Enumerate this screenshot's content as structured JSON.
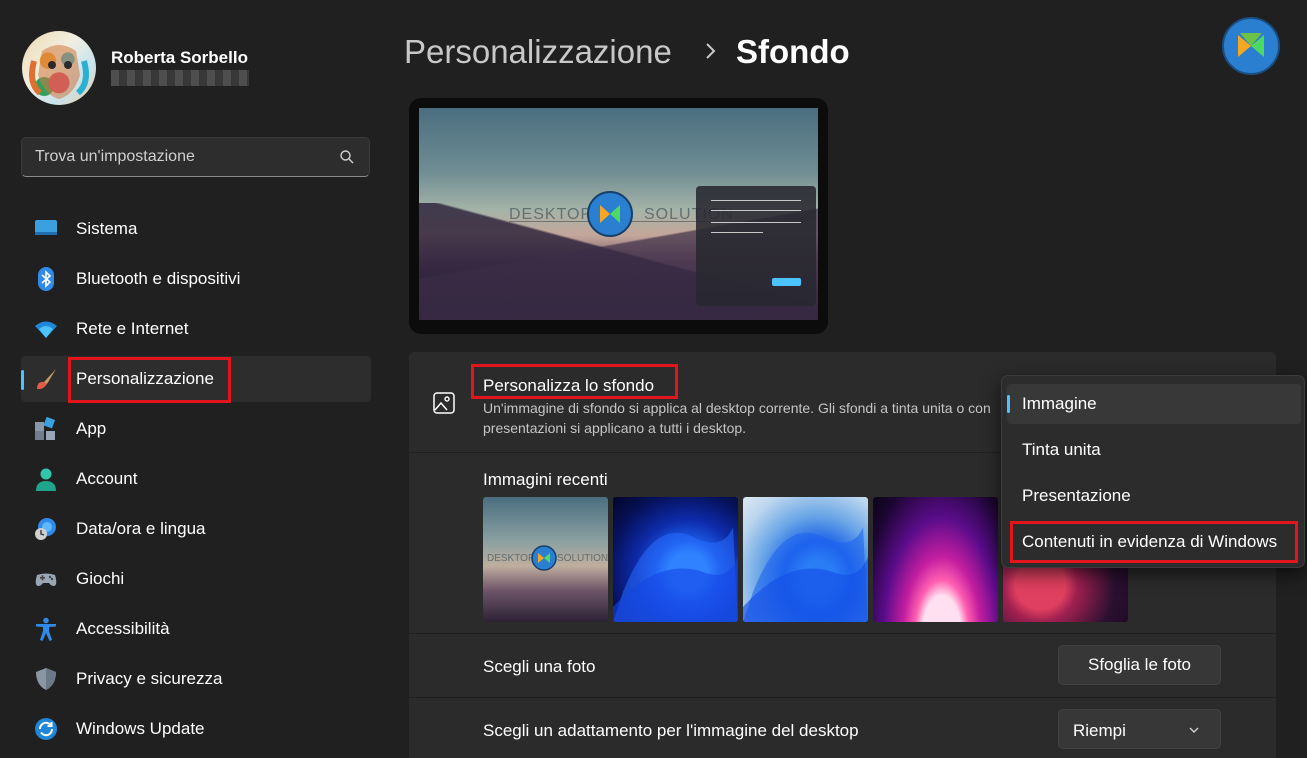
{
  "user": {
    "name": "Roberta Sorbello"
  },
  "search": {
    "placeholder": "Trova un'impostazione"
  },
  "sidebar": {
    "items": [
      {
        "label": "Sistema"
      },
      {
        "label": "Bluetooth e dispositivi"
      },
      {
        "label": "Rete e Internet"
      },
      {
        "label": "Personalizzazione",
        "active": true
      },
      {
        "label": "App"
      },
      {
        "label": "Account"
      },
      {
        "label": "Data/ora e lingua"
      },
      {
        "label": "Giochi"
      },
      {
        "label": "Accessibilità"
      },
      {
        "label": "Privacy e sicurezza"
      },
      {
        "label": "Windows Update"
      }
    ]
  },
  "header": {
    "breadcrumb_parent": "Personalizzazione",
    "breadcrumb_current": "Sfondo"
  },
  "preview": {
    "text_left": "DESKTOP",
    "text_right": "SOLUTION"
  },
  "background": {
    "title": "Personalizza lo sfondo",
    "description": "Un'immagine di sfondo si applica al desktop corrente. Gli sfondi a tinta unita o con presentazioni si applicano a tutti i desktop.",
    "dropdown_options": [
      "Immagine",
      "Tinta unita",
      "Presentazione",
      "Contenuti in evidenza di Windows"
    ],
    "selected_option": "Immagine"
  },
  "recent": {
    "title": "Immagini recenti"
  },
  "photo": {
    "label": "Scegli una foto",
    "browse_label": "Sfoglia le foto"
  },
  "fit": {
    "label": "Scegli un adattamento per l'immagine del desktop",
    "value": "Riempi"
  },
  "colors": {
    "accent": "#4cc2ff",
    "highlight": "#e3141b",
    "background": "#202020",
    "card": "#2b2b2b"
  }
}
